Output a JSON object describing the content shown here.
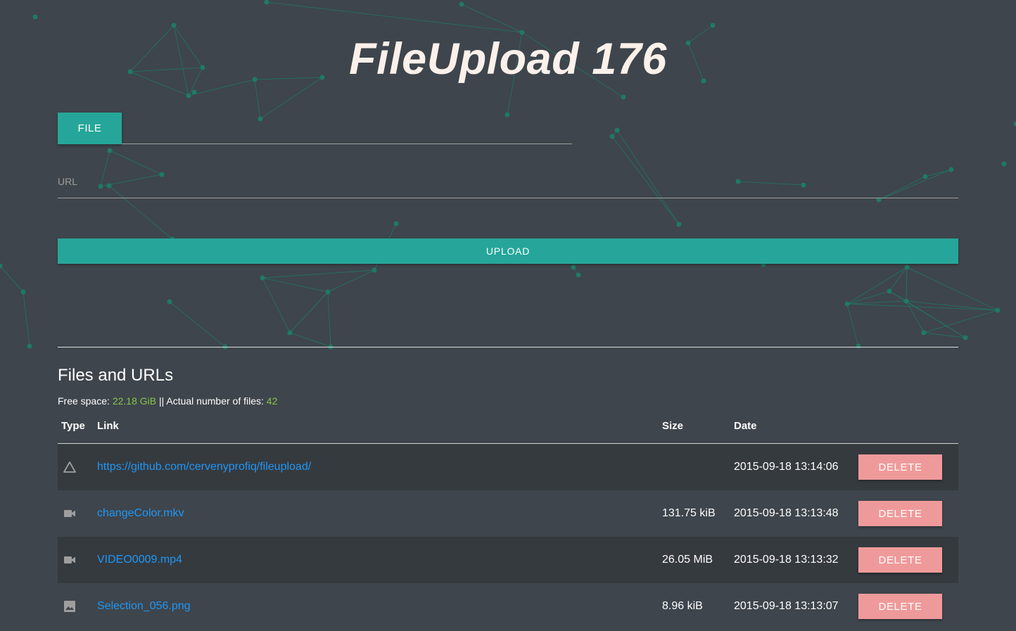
{
  "page": {
    "title": "FileUpload 176"
  },
  "upload_form": {
    "file_button_label": "FILE",
    "file_path_value": "",
    "url_label": "URL",
    "url_value": "",
    "upload_button_label": "UPLOAD"
  },
  "files_section": {
    "heading": "Files and URLs",
    "free_space_label": "Free space: ",
    "free_space_value": "22.18 GiB",
    "separator": " || ",
    "file_count_label": "Actual number of files: ",
    "file_count_value": "42",
    "columns": [
      "Type",
      "Link",
      "Size",
      "Date"
    ],
    "rows": [
      {
        "type_icon": "warning-triangle-icon",
        "link": "https://github.com/cervenyprofiq/fileupload/",
        "size": "",
        "date": "2015-09-18 13:14:06",
        "delete_label": "DELETE"
      },
      {
        "type_icon": "video-camera-icon",
        "link": "changeColor.mkv",
        "size": "131.75 kiB",
        "date": "2015-09-18 13:13:48",
        "delete_label": "DELETE"
      },
      {
        "type_icon": "video-camera-icon",
        "link": "VIDEO0009.mp4",
        "size": "26.05 MiB",
        "date": "2015-09-18 13:13:32",
        "delete_label": "DELETE"
      },
      {
        "type_icon": "image-icon",
        "link": "Selection_056.png",
        "size": "8.96 kiB",
        "date": "2015-09-18 13:13:07",
        "delete_label": "DELETE"
      }
    ]
  },
  "colors": {
    "background": "#3e454c",
    "accent": "#26a69a",
    "link": "#2196f3",
    "delete": "#ef9a9a",
    "highlight": "#8bc34a",
    "network": "#1f7a63"
  }
}
